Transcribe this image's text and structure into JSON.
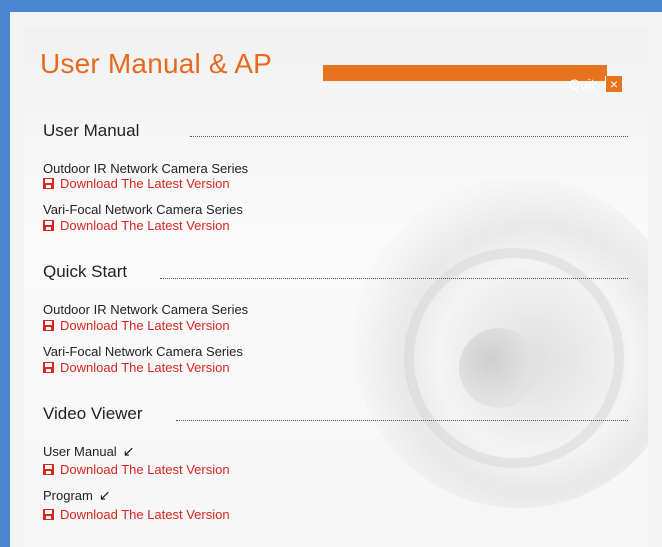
{
  "header": {
    "title": "User Manual & AP",
    "quit_label": "Quit",
    "close_glyph": "×"
  },
  "sections": [
    {
      "heading": "User Manual",
      "items": [
        {
          "label": "Outdoor IR Network Camera Series",
          "download": "Download The Latest Version"
        },
        {
          "label": "Vari-Focal Network Camera Series",
          "download": "Download The Latest Version"
        }
      ]
    },
    {
      "heading": "Quick Start",
      "items": [
        {
          "label": "Outdoor IR Network Camera Series",
          "download": "Download The Latest Version"
        },
        {
          "label": "Vari-Focal Network Camera Series",
          "download": "Download The Latest Version"
        }
      ]
    },
    {
      "heading": "Video Viewer",
      "items": [
        {
          "label": "User Manual",
          "download": "Download The Latest Version",
          "arrow": "↙"
        },
        {
          "label": "Program",
          "download": "Download The Latest Version",
          "arrow": "↙"
        }
      ]
    }
  ],
  "colors": {
    "accent": "#e8731f",
    "link": "#d7261f",
    "frame": "#4a86cf"
  },
  "icons": {
    "download": "floppy-disk-icon",
    "arrow": "arrow-down-left-icon"
  }
}
